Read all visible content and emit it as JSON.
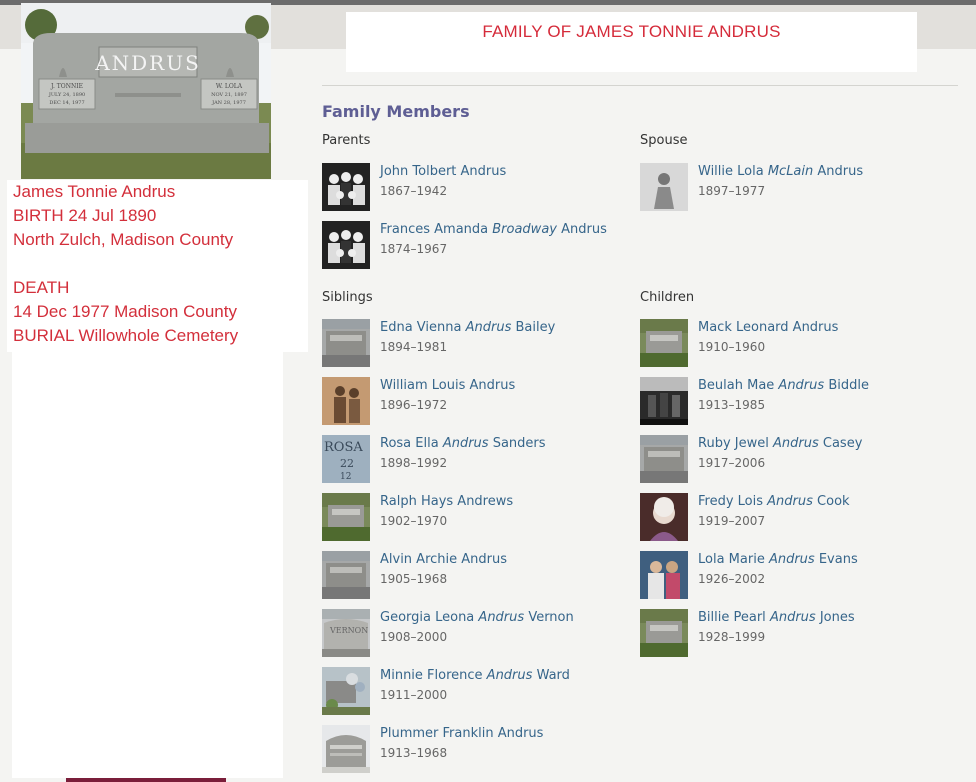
{
  "header": {
    "title": "FAMILY OF JAMES TONNIE ANDRUS"
  },
  "headstone": {
    "surname": "ANDRUS",
    "left_plate": [
      "J. TONNIE",
      "JULY 24, 1890",
      "DEC 14, 1977"
    ],
    "right_plate": [
      "W. LOLA",
      "NOV 21, 1897",
      "JAN 28, 1977"
    ]
  },
  "info": {
    "name": "James Tonnie Andrus",
    "birth": "BIRTH  24 Jul 1890",
    "birth_place": "North Zulch, Madison County",
    "death_label": "DEATH",
    "death": "14 Dec 1977 Madison County",
    "burial": "BURIAL Willowhole Cemetery"
  },
  "family": {
    "heading": "Family Members",
    "parents": {
      "label": "Parents",
      "people": [
        {
          "first": "John Tolbert",
          "maiden": "",
          "last": "Andrus",
          "dates": "1867–1942"
        },
        {
          "first": "Frances Amanda",
          "maiden": "Broadway",
          "last": "Andrus",
          "dates": "1874–1967"
        }
      ]
    },
    "spouse": {
      "label": "Spouse",
      "people": [
        {
          "first": "Willie Lola",
          "maiden": "McLain",
          "last": "Andrus",
          "dates": "1897–1977"
        }
      ]
    },
    "siblings": {
      "label": "Siblings",
      "people": [
        {
          "first": "Edna Vienna",
          "maiden": "Andrus",
          "last": "Bailey",
          "dates": "1894–1981"
        },
        {
          "first": "William Louis",
          "maiden": "",
          "last": "Andrus",
          "dates": "1896–1972"
        },
        {
          "first": "Rosa Ella",
          "maiden": "Andrus",
          "last": "Sanders",
          "dates": "1898–1992"
        },
        {
          "first": "Ralph Hays",
          "maiden": "",
          "last": "Andrews",
          "dates": "1902–1970"
        },
        {
          "first": "Alvin Archie",
          "maiden": "",
          "last": "Andrus",
          "dates": "1905–1968"
        },
        {
          "first": "Georgia Leona",
          "maiden": "Andrus",
          "last": "Vernon",
          "dates": "1908–2000"
        },
        {
          "first": "Minnie Florence",
          "maiden": "Andrus",
          "last": "Ward",
          "dates": "1911–2000"
        },
        {
          "first": "Plummer Franklin",
          "maiden": "",
          "last": "Andrus",
          "dates": "1913–1968"
        }
      ]
    },
    "children": {
      "label": "Children",
      "people": [
        {
          "first": "Mack Leonard",
          "maiden": "",
          "last": "Andrus",
          "dates": "1910–1960"
        },
        {
          "first": "Beulah Mae",
          "maiden": "Andrus",
          "last": "Biddle",
          "dates": "1913–1985"
        },
        {
          "first": "Ruby Jewel",
          "maiden": "Andrus",
          "last": "Casey",
          "dates": "1917–2006"
        },
        {
          "first": "Fredy Lois",
          "maiden": "Andrus",
          "last": "Cook",
          "dates": "1919–2007"
        },
        {
          "first": "Lola Marie",
          "maiden": "Andrus",
          "last": "Evans",
          "dates": "1926–2002"
        },
        {
          "first": "Billie Pearl",
          "maiden": "Andrus",
          "last": "Jones",
          "dates": "1928–1999"
        }
      ]
    }
  },
  "colors": {
    "title_red": "#d52b3a",
    "link_blue": "#36658a",
    "heading_purple": "#5e5e94"
  }
}
